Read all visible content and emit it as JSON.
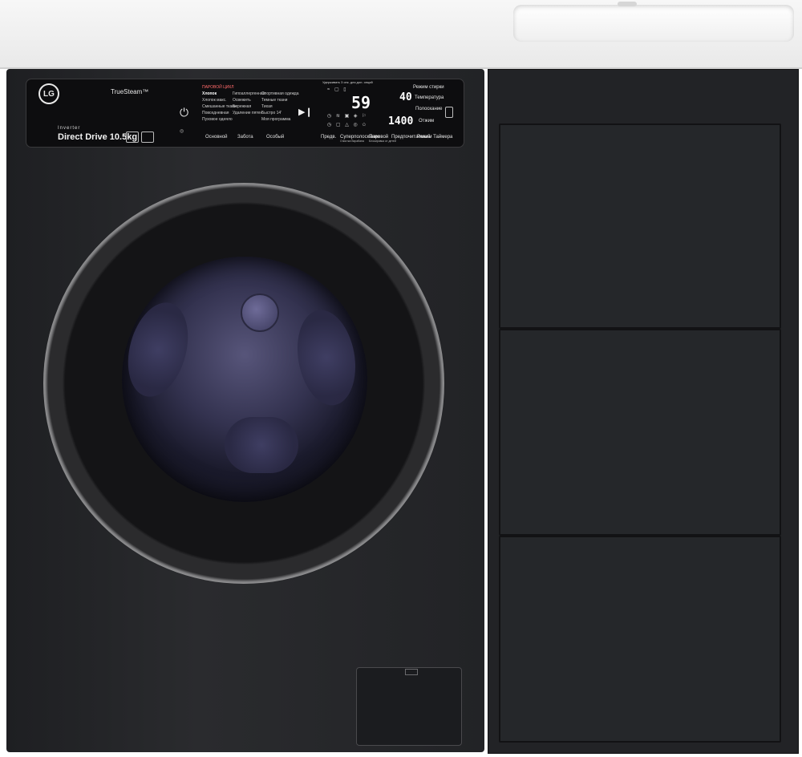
{
  "brand": {
    "logo_text": "LG",
    "truesteam": "TrueSteam™",
    "inverter": "Inverter",
    "direct_drive": "Direct Drive 10.5kg"
  },
  "programs": {
    "header": "ПАРОВОЙ ЦИКЛ",
    "col1": [
      "Хлопок",
      "Хлопок макс.",
      "Смешанные ткани",
      "Повседневная",
      "Пуховое одеяло"
    ],
    "col2": [
      "Гипоаллергенная",
      "Освежить",
      "Бережная",
      "Удаление пятен",
      ""
    ],
    "col3": [
      "Спортивная одежда",
      "Темные ткани",
      "Тихая",
      "Быстро 14'",
      "Моя программа"
    ],
    "groups": [
      "Основной",
      "Забота",
      "Особый"
    ]
  },
  "display": {
    "hint": "Удерживать 3 сек. для доп. опций",
    "digits_time": "59",
    "digits_temp": "40",
    "digits_spin": "1400",
    "labels": [
      "Режим стирки",
      "Температура",
      "Полоскание",
      "Отжим"
    ]
  },
  "buttons": {
    "pre": "Предв.",
    "rinse_plus": "Суперполоскание",
    "rinse_plus_sub": "Очистка барабана",
    "steam": "Паровой",
    "steam_sub": "Блокировка от детей",
    "prewash_fav": "Предпочитаемый",
    "timer": "Режим Таймера"
  },
  "icons": [
    "power-icon",
    "play-pause-icon",
    "smart-diagnosis-icon",
    "phone-icon"
  ]
}
